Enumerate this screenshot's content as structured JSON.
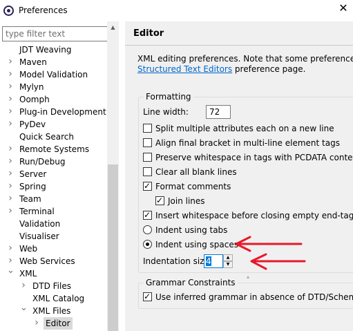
{
  "window": {
    "title": "Preferences",
    "close_glyph": "✕"
  },
  "filter": {
    "placeholder": "type filter text",
    "value": ""
  },
  "tree": {
    "items": [
      {
        "label": "JDT Weaving",
        "level": 0,
        "expandable": false
      },
      {
        "label": "Maven",
        "level": 0,
        "expandable": true,
        "expanded": false
      },
      {
        "label": "Model Validation",
        "level": 0,
        "expandable": true,
        "expanded": false
      },
      {
        "label": "Mylyn",
        "level": 0,
        "expandable": true,
        "expanded": false
      },
      {
        "label": "Oomph",
        "level": 0,
        "expandable": true,
        "expanded": false
      },
      {
        "label": "Plug-in Development",
        "level": 0,
        "expandable": true,
        "expanded": false
      },
      {
        "label": "PyDev",
        "level": 0,
        "expandable": true,
        "expanded": false
      },
      {
        "label": "Quick Search",
        "level": 0,
        "expandable": false
      },
      {
        "label": "Remote Systems",
        "level": 0,
        "expandable": true,
        "expanded": false
      },
      {
        "label": "Run/Debug",
        "level": 0,
        "expandable": true,
        "expanded": false
      },
      {
        "label": "Server",
        "level": 0,
        "expandable": true,
        "expanded": false
      },
      {
        "label": "Spring",
        "level": 0,
        "expandable": true,
        "expanded": false
      },
      {
        "label": "Team",
        "level": 0,
        "expandable": true,
        "expanded": false
      },
      {
        "label": "Terminal",
        "level": 0,
        "expandable": true,
        "expanded": false
      },
      {
        "label": "Validation",
        "level": 0,
        "expandable": false
      },
      {
        "label": "Visualiser",
        "level": 0,
        "expandable": false
      },
      {
        "label": "Web",
        "level": 0,
        "expandable": true,
        "expanded": false
      },
      {
        "label": "Web Services",
        "level": 0,
        "expandable": true,
        "expanded": false
      },
      {
        "label": "XML",
        "level": 0,
        "expandable": true,
        "expanded": true
      },
      {
        "label": "DTD Files",
        "level": 1,
        "expandable": true,
        "expanded": false
      },
      {
        "label": "XML Catalog",
        "level": 1,
        "expandable": false
      },
      {
        "label": "XML Files",
        "level": 1,
        "expandable": true,
        "expanded": true
      },
      {
        "label": "Editor",
        "level": 2,
        "expandable": true,
        "expanded": false,
        "selected": true
      }
    ]
  },
  "page": {
    "title": "Editor",
    "description_line1": "XML editing preferences.  Note that some preferences may",
    "description_link": "Structured Text Editors",
    "description_line2_suffix": " preference page."
  },
  "formatting": {
    "group_label": "Formatting",
    "line_width_label": "Line width:",
    "line_width_value": "72",
    "options": [
      {
        "label": "Split multiple attributes each on a new line",
        "type": "checkbox",
        "checked": false,
        "indent": false
      },
      {
        "label": "Align final bracket in multi-line element tags",
        "type": "checkbox",
        "checked": false,
        "indent": false
      },
      {
        "label": "Preserve whitespace in tags with PCDATA content",
        "type": "checkbox",
        "checked": false,
        "indent": false
      },
      {
        "label": "Clear all blank lines",
        "type": "checkbox",
        "checked": false,
        "indent": false
      },
      {
        "label": "Format comments",
        "type": "checkbox",
        "checked": true,
        "indent": false
      },
      {
        "label": "Join lines",
        "type": "checkbox",
        "checked": true,
        "indent": true
      },
      {
        "label": "Insert whitespace before closing empty end-tags",
        "type": "checkbox",
        "checked": true,
        "indent": false
      },
      {
        "label": "Indent using tabs",
        "type": "radio",
        "checked": false,
        "indent": false
      },
      {
        "label": "Indent using spaces",
        "type": "radio",
        "checked": true,
        "indent": false
      }
    ],
    "indentation_size_label": "Indentation size:",
    "indentation_size_value": "4"
  },
  "grammar": {
    "group_label": "Grammar Constraints",
    "options": [
      {
        "label": "Use inferred grammar in absence of DTD/Schema",
        "type": "checkbox",
        "checked": true
      }
    ]
  },
  "colors": {
    "annotation_red": "#e8182a",
    "link": "#0066cc",
    "selection": "#d9d9d9",
    "pane_bg": "#f0f0f0"
  }
}
